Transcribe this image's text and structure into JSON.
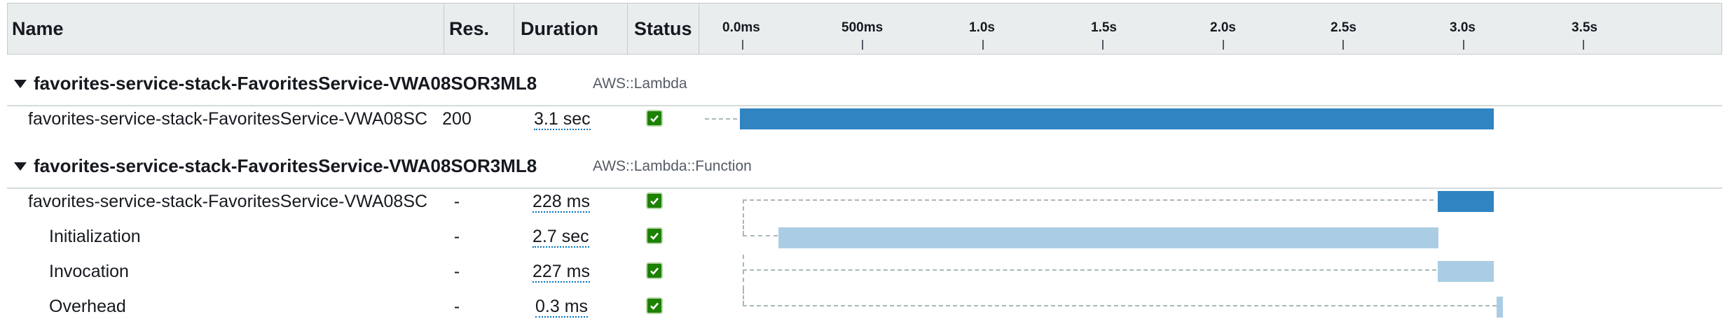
{
  "header": {
    "name": "Name",
    "res": "Res.",
    "duration": "Duration",
    "status": "Status",
    "ticks": [
      "0.0ms",
      "500ms",
      "1.0s",
      "1.5s",
      "2.0s",
      "2.5s",
      "3.0s",
      "3.5s"
    ]
  },
  "groups": [
    {
      "name": "favorites-service-stack-FavoritesService-VWA08SOR3ML8",
      "type": "AWS::Lambda"
    },
    {
      "name": "favorites-service-stack-FavoritesService-VWA08SOR3ML8",
      "type": "AWS::Lambda::Function"
    }
  ],
  "rows": [
    {
      "name": "favorites-service-stack-FavoritesService-VWA08SC",
      "res": "200",
      "duration": "3.1 sec",
      "status": "ok"
    },
    {
      "name": "favorites-service-stack-FavoritesService-VWA08SC",
      "res": "-",
      "duration": "228 ms",
      "status": "ok"
    },
    {
      "name": "Initialization",
      "res": "-",
      "duration": "2.7 sec",
      "status": "ok"
    },
    {
      "name": "Invocation",
      "res": "-",
      "duration": "227 ms",
      "status": "ok"
    },
    {
      "name": "Overhead",
      "res": "-",
      "duration": "0.3 ms",
      "status": "ok"
    }
  ],
  "colors": {
    "primary_bar": "#3184c2",
    "secondary_bar": "#abcde3",
    "status_ok": "#1d8102"
  }
}
